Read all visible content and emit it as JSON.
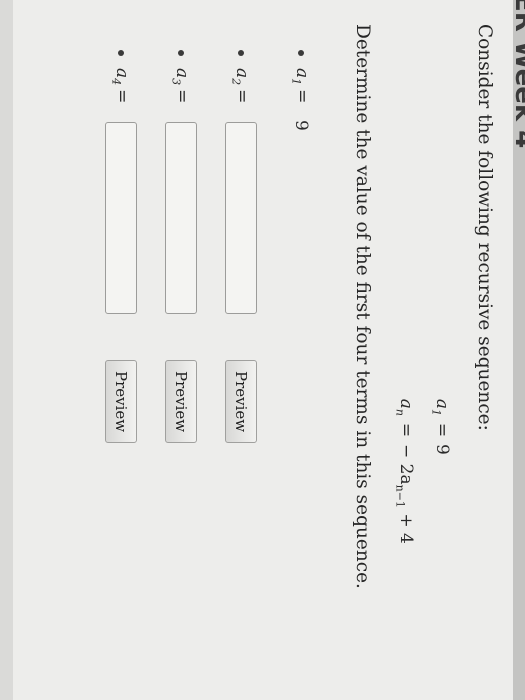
{
  "header": {
    "title_fragment": "ER Week 4"
  },
  "question": {
    "intro": "Consider the following recursive sequence:",
    "equations": [
      {
        "lhs": "a",
        "lhs_sub": "1",
        "rhs": "9"
      },
      {
        "lhs": "a",
        "lhs_sub": "n",
        "rhs_prefix": "− 2a",
        "rhs_sub": "n−1",
        "rhs_suffix": " + 4"
      }
    ],
    "instruction": "Determine the value of the first four terms in this sequence.",
    "terms": [
      {
        "var": "a",
        "sub": "1",
        "value": "9"
      },
      {
        "var": "a",
        "sub": "2",
        "input_value": "",
        "preview_label": "Preview"
      },
      {
        "var": "a",
        "sub": "3",
        "input_value": "",
        "preview_label": "Preview"
      },
      {
        "var": "a",
        "sub": "4",
        "input_value": "",
        "preview_label": "Preview"
      }
    ]
  }
}
